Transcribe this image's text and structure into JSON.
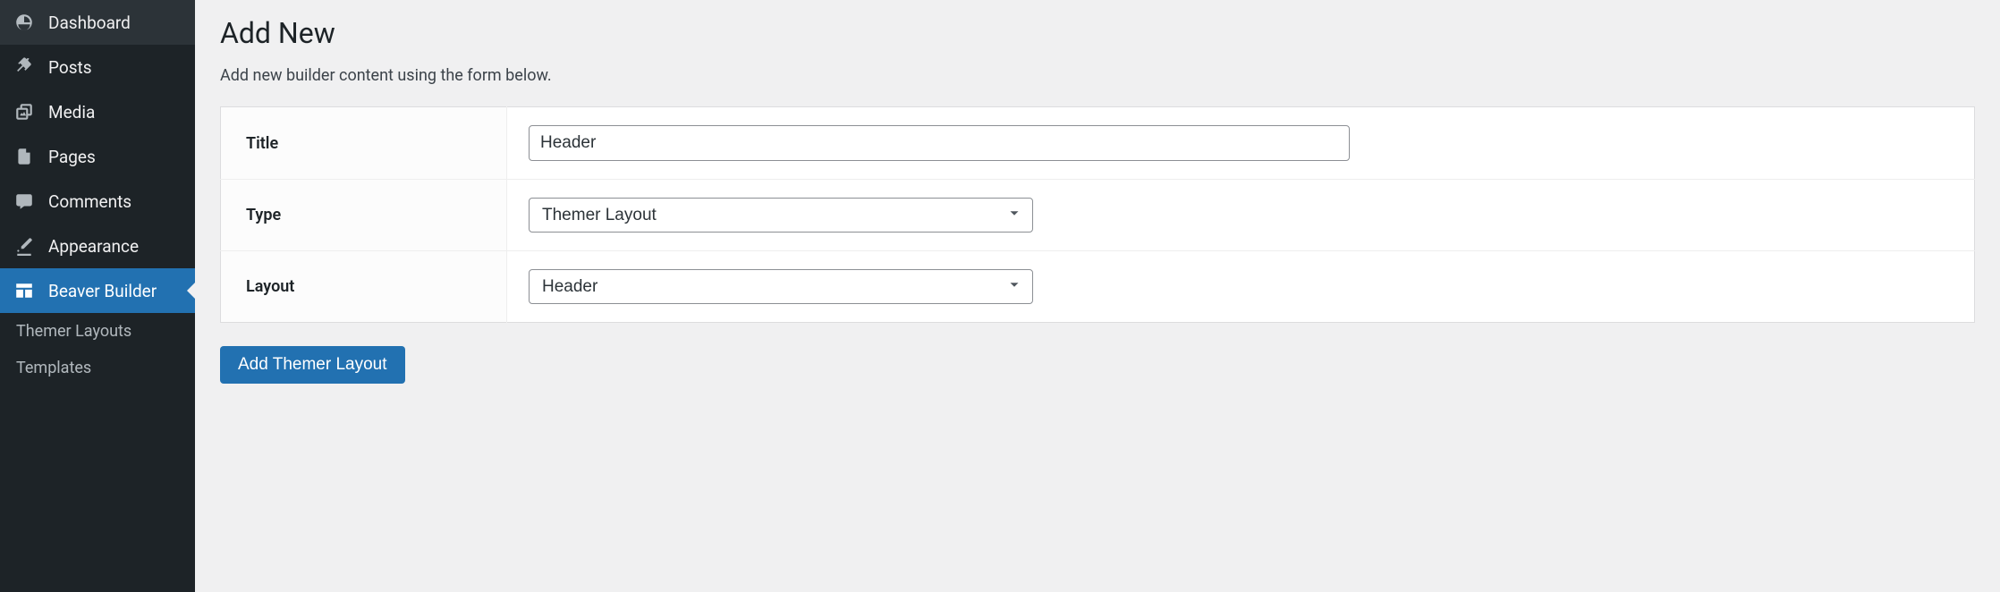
{
  "sidebar": {
    "items": [
      {
        "label": "Dashboard"
      },
      {
        "label": "Posts"
      },
      {
        "label": "Media"
      },
      {
        "label": "Pages"
      },
      {
        "label": "Comments"
      },
      {
        "label": "Appearance"
      },
      {
        "label": "Beaver Builder"
      }
    ],
    "sub": [
      {
        "label": "Themer Layouts"
      },
      {
        "label": "Templates"
      }
    ]
  },
  "main": {
    "page_title": "Add New",
    "description": "Add new builder content using the form below.",
    "form": {
      "title_label": "Title",
      "title_value": "Header",
      "type_label": "Type",
      "type_value": "Themer Layout",
      "layout_label": "Layout",
      "layout_value": "Header"
    },
    "submit_label": "Add Themer Layout"
  }
}
